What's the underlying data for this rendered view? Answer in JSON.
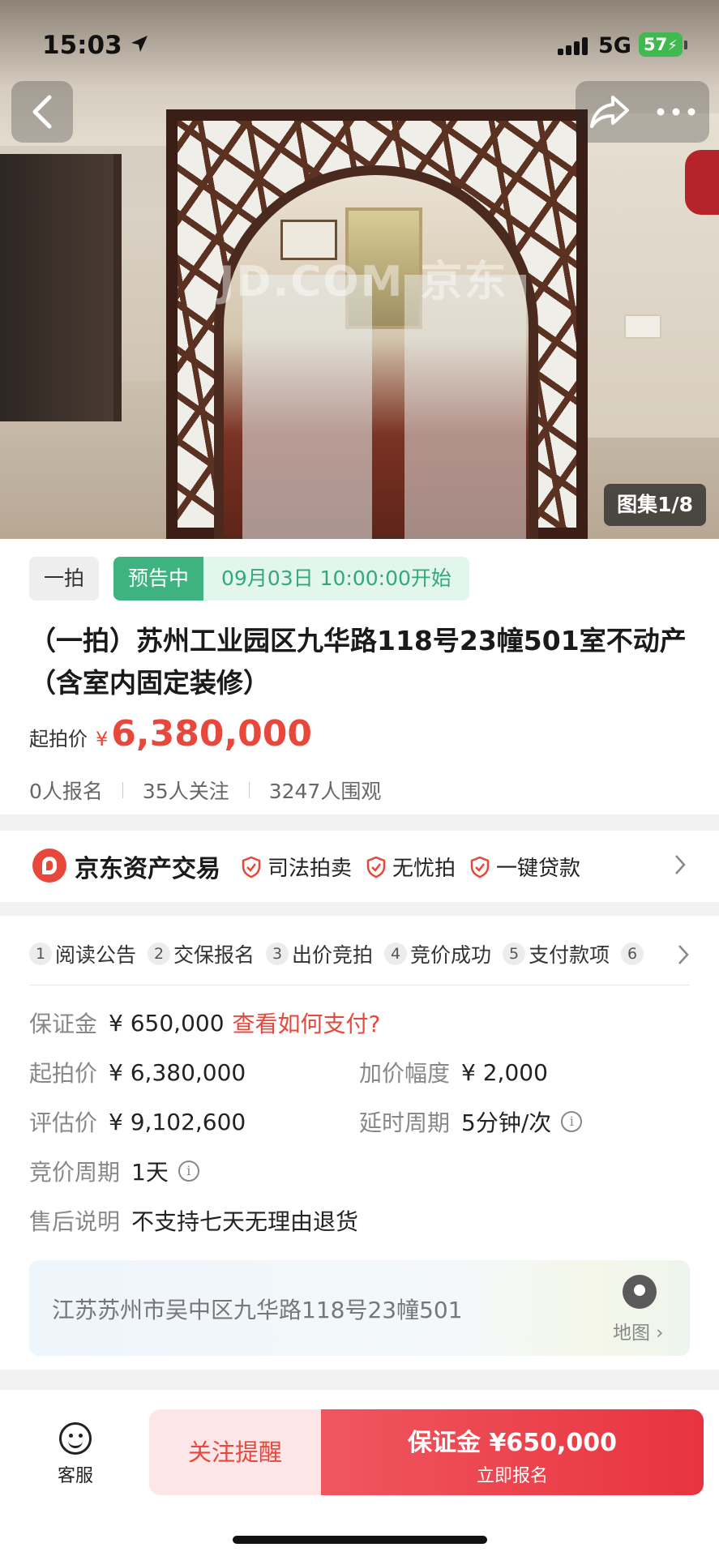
{
  "status_bar": {
    "time": "15:03",
    "network": "5G",
    "battery": "57"
  },
  "hero": {
    "watermark": "JD.COM 京东",
    "album_label": "图集1/8"
  },
  "auction": {
    "round_tag": "一拍",
    "status_tag": "预告中",
    "start_time": "09月03日 10:00:00开始",
    "title": "（一拍）苏州工业园区九华路118号23幢501室不动产（含室内固定装修）",
    "start_price_label": "起拍价",
    "currency_symbol": "¥",
    "start_price": "6,380,000",
    "stats": [
      "0人报名",
      "35人关注",
      "3247人围观"
    ]
  },
  "brand": {
    "name": "京东资产交易",
    "features": [
      "司法拍卖",
      "无忧拍",
      "一键贷款"
    ]
  },
  "steps": [
    {
      "num": "1",
      "label": "阅读公告"
    },
    {
      "num": "2",
      "label": "交保报名"
    },
    {
      "num": "3",
      "label": "出价竞拍"
    },
    {
      "num": "4",
      "label": "竞价成功"
    },
    {
      "num": "5",
      "label": "支付款项"
    },
    {
      "num": "6",
      "label": ""
    }
  ],
  "details": {
    "deposit_label": "保证金",
    "deposit_value": "¥ 650,000",
    "deposit_link": "查看如何支付?",
    "start_price_label": "起拍价",
    "start_price_value": "¥ 6,380,000",
    "increment_label": "加价幅度",
    "increment_value": "¥ 2,000",
    "valuation_label": "评估价",
    "valuation_value": "¥ 9,102,600",
    "extension_label": "延时周期",
    "extension_value": "5分钟/次",
    "bid_period_label": "竞价周期",
    "bid_period_value": "1天",
    "after_sale_label": "售后说明",
    "after_sale_value": "不支持七天无理由退货"
  },
  "address": {
    "text": "江苏苏州市吴中区九华路118号23幢501",
    "map_label": "地图"
  },
  "bottom": {
    "service_label": "客服",
    "follow_label": "关注提醒",
    "signup_line1": "保证金 ¥650,000",
    "signup_line2": "立即报名"
  },
  "colors": {
    "accent_red": "#e8483b",
    "green": "#3fb37f"
  }
}
